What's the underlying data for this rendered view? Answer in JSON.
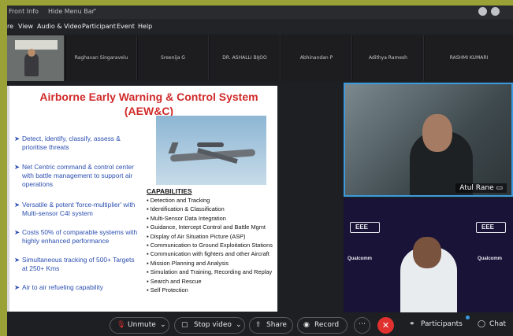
{
  "titlebar": {
    "front_info": "Front Info",
    "hide_menu_bar": "Hide Menu Bar"
  },
  "menu": [
    "re",
    "View",
    "Audio & Video",
    "Participant",
    "Event",
    "Help"
  ],
  "strip": {
    "names": [
      "Raghavan Singaravelu",
      "Sreenija G",
      "DR. ASHALLI BIJOO",
      "Abhinandan P",
      "Adithya Ramesh",
      "RASHMI KUMARI"
    ]
  },
  "slide": {
    "title_line1": "Airborne Early Warning & Control System",
    "title_line2": "(AEW&C)",
    "bullets": [
      "Detect, identify, classify, assess & prioritise threats",
      "Net Centric command & control center with battle management to support air operations",
      "Versatile & potent 'force-multiplier' with Multi-sensor C4I system",
      "Costs 50% of comparable systems with highly enhanced performance",
      "Simultaneous tracking of 500+ Targets at 250+ Kms",
      "Air to air refueling capability"
    ],
    "capabilities_heading": "CAPABILITIES",
    "capabilities": [
      "Detection and Tracking",
      "Identification & Classification",
      "Multi-Sensor Data Integration",
      "Guidance, Intercept Control and Battle Mgmt",
      "Display of Air Situation Picture (ASP)",
      "Communication to Ground Exploitation Stations",
      "Communication with fighters and other Aircraft",
      "Mission Planning and Analysis",
      "Simulation and Training, Recording and Replay",
      "Search and Rescue",
      "Self Protection"
    ]
  },
  "tiles": {
    "speaker_name": "Atul Rane",
    "brand_text": "EEE",
    "brand_text2": "Qualcomm"
  },
  "toolbar": {
    "unmute": "Unmute",
    "stop_video": "Stop video",
    "share": "Share",
    "record": "Record",
    "participants": "Participants",
    "chat": "Chat"
  },
  "colors": {
    "frame": "#9aa237",
    "slide_title": "#d12b2b",
    "slide_bullets": "#2c4fb0",
    "active_speaker_border": "#3b9be0",
    "end_call": "#e0312f"
  }
}
